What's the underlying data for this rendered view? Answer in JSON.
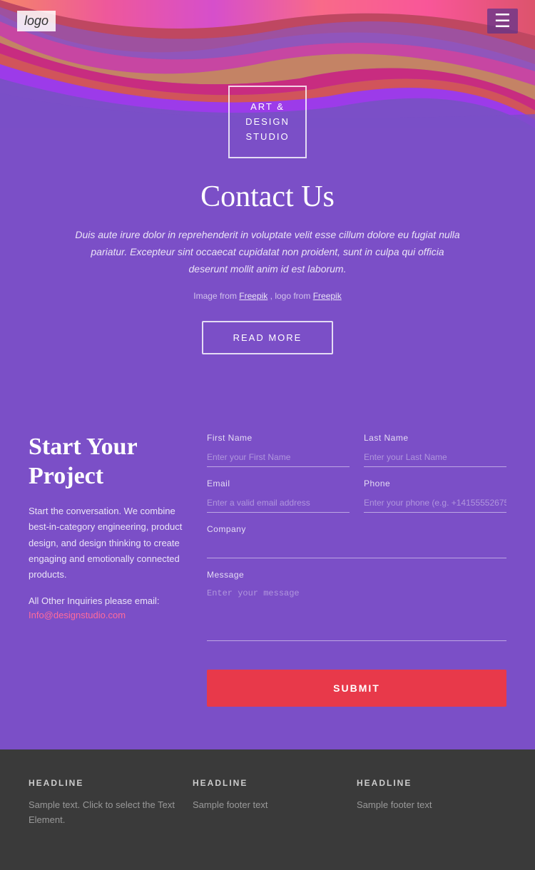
{
  "nav": {
    "logo": "logo",
    "hamburger_icon": "☰"
  },
  "studio_box": {
    "line1": "ART &",
    "line2": "DESIGN",
    "line3": "STUDIO"
  },
  "contact": {
    "title": "Contact Us",
    "description": "Duis aute irure dolor in reprehenderit in voluptate velit esse cillum dolore eu fugiat nulla pariatur. Excepteur sint occaecat cupidatat non proident, sunt in culpa qui officia deserunt mollit anim id est laborum.",
    "image_credit_prefix": "Image from",
    "image_credit_freepik1": "Freepik",
    "image_credit_sep": ", logo from",
    "image_credit_freepik2": "Freepik",
    "read_more_label": "READ MORE"
  },
  "project": {
    "title": "Start Your Project",
    "description": "Start the conversation. We combine best-in-category engineering, product design, and design thinking to create engaging and emotionally connected products.",
    "email_label": "All Other Inquiries please email:",
    "email": "Info@designstudio.com"
  },
  "form": {
    "first_name_label": "First Name",
    "first_name_placeholder": "Enter your First Name",
    "last_name_label": "Last Name",
    "last_name_placeholder": "Enter your Last Name",
    "email_label": "Email",
    "email_placeholder": "Enter a valid email address",
    "phone_label": "Phone",
    "phone_placeholder": "Enter your phone (e.g. +14155552675",
    "company_label": "Company",
    "company_placeholder": "",
    "message_label": "Message",
    "message_placeholder": "Enter your message",
    "submit_label": "SUBMIT"
  },
  "footer": {
    "columns": [
      {
        "headline": "HEADLINE",
        "text": "Sample text. Click to select the Text Element."
      },
      {
        "headline": "HEADLINE",
        "text": "Sample footer text"
      },
      {
        "headline": "HEADLINE",
        "text": "Sample footer text"
      }
    ]
  }
}
